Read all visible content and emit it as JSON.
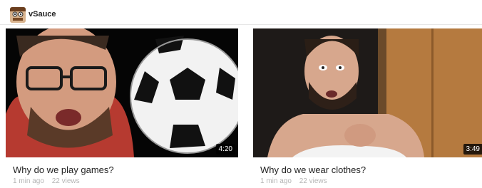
{
  "channel": {
    "name": "vSauce"
  },
  "videos": [
    {
      "title": "Why do we play games?",
      "duration": "4:20",
      "age": "1 min ago",
      "views": "22 views"
    },
    {
      "title": "Why do we wear clothes?",
      "duration": "3:49",
      "age": "1 min ago",
      "views": "22 views"
    }
  ]
}
